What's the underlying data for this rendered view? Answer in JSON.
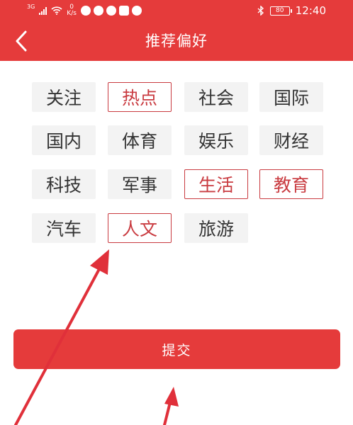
{
  "status_bar": {
    "network": "3G",
    "speed_value": "0",
    "speed_unit": "K/s",
    "battery": "80",
    "time": "12:40",
    "icons": [
      "signal-icon",
      "wifi-icon",
      "app-notification-icon",
      "bluetooth-icon",
      "battery-icon"
    ]
  },
  "header": {
    "title": "推荐偏好",
    "back_icon": "chevron-left-icon"
  },
  "tags": [
    {
      "label": "关注",
      "selected": false
    },
    {
      "label": "热点",
      "selected": true
    },
    {
      "label": "社会",
      "selected": false
    },
    {
      "label": "国际",
      "selected": false
    },
    {
      "label": "国内",
      "selected": false
    },
    {
      "label": "体育",
      "selected": false
    },
    {
      "label": "娱乐",
      "selected": false
    },
    {
      "label": "财经",
      "selected": false
    },
    {
      "label": "科技",
      "selected": false
    },
    {
      "label": "军事",
      "selected": false
    },
    {
      "label": "生活",
      "selected": true
    },
    {
      "label": "教育",
      "selected": true
    },
    {
      "label": "汽车",
      "selected": false
    },
    {
      "label": "人文",
      "selected": true
    },
    {
      "label": "旅游",
      "selected": false
    }
  ],
  "submit_button": {
    "label": "提交"
  },
  "colors": {
    "brand": "#e53b3b",
    "selected_border": "#c93b40",
    "tag_bg": "#f3f3f3",
    "tag_text": "#333333",
    "annotation_arrow": "#e0303a"
  }
}
